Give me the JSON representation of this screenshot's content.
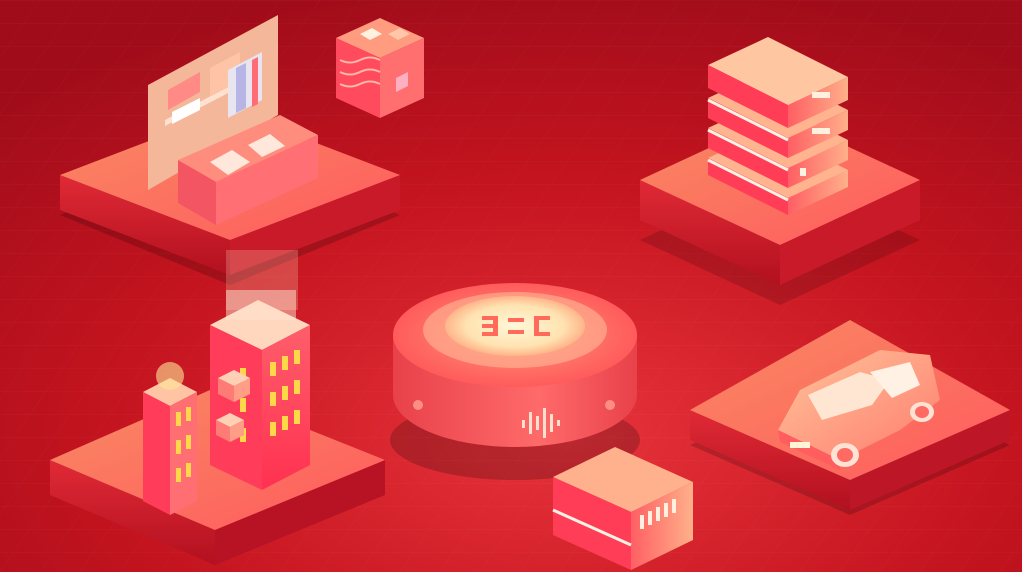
{
  "image": {
    "kind": "isometric illustration",
    "palette": {
      "background": "#b5101f",
      "background_light": "#e3303a",
      "platform_top": "#f7745c",
      "platform_side": "#c01828",
      "accent_glow": "#fff4c8",
      "building": "#ff4d5a",
      "window": "#ffd84a",
      "server": "#ff6a5f",
      "car": "#ffb28a"
    }
  },
  "hub": {
    "icon_name": "cloud-hub-logo-icon",
    "glyphs": [
      "ヨ",
      "ニ",
      "匚"
    ]
  },
  "scenes": [
    {
      "name": "living-room-platform",
      "icon": "home-icon"
    },
    {
      "name": "crate-cube",
      "icon": "package-icon"
    },
    {
      "name": "server-stack-platform",
      "icon": "server-icon"
    },
    {
      "name": "city-buildings-platform",
      "icon": "building-icon"
    },
    {
      "name": "car-platform",
      "icon": "car-icon"
    },
    {
      "name": "small-server",
      "icon": "router-icon"
    }
  ]
}
